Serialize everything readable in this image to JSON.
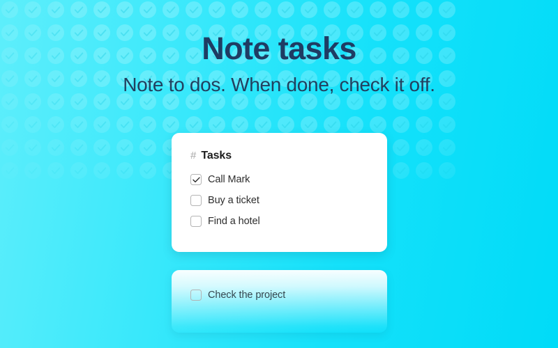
{
  "hero": {
    "title": "Note tasks",
    "subtitle": "Note to dos. When done, check it off."
  },
  "colors": {
    "background_left": "#5eeefb",
    "background_right": "#00dbf8",
    "heading_text": "#1f3c63",
    "card_background": "#ffffff",
    "checkbox_border": "#b4b4b4",
    "check_mark": "#2b2b2b",
    "hash_mark": "#a6a6a6"
  },
  "background_pattern": {
    "icon": "check-circle-icon",
    "columns": 20,
    "rows": 8,
    "spacing_px": 33
  },
  "cards": [
    {
      "name": "tasks-card",
      "hash": "#",
      "title": "Tasks",
      "tasks": [
        {
          "label": "Call Mark",
          "checked": true,
          "icon": "checkbox-checked-icon"
        },
        {
          "label": "Buy a ticket",
          "checked": false,
          "icon": "checkbox-icon"
        },
        {
          "label": "Find a hotel",
          "checked": false,
          "icon": "checkbox-icon"
        }
      ]
    },
    {
      "name": "secondary-card",
      "tasks": [
        {
          "label": "Check the project",
          "checked": false,
          "icon": "checkbox-icon"
        }
      ]
    }
  ]
}
